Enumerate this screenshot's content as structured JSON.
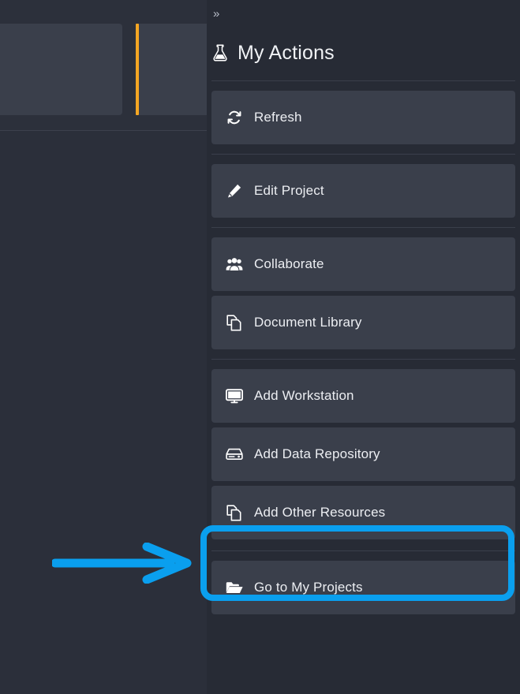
{
  "window": {
    "background_color": "#272b35",
    "panel_background_color": "#272b35",
    "card_color": "#3a3f4b"
  },
  "left_pane": {
    "accent_bar_color": "#f5a623",
    "card_color": "#3a3f4b",
    "background_color": "#2c303b"
  },
  "panel": {
    "collapse_chevron": "»",
    "title": "My Actions",
    "title_icon": "flask-icon",
    "groups": [
      {
        "group_name": "refresh-group",
        "items": [
          {
            "label": "Refresh",
            "icon": "refresh-icon",
            "tight": false
          }
        ]
      },
      {
        "group_name": "edit-group",
        "items": [
          {
            "label": "Edit Project",
            "icon": "pencil-icon",
            "tight": false
          }
        ]
      },
      {
        "group_name": "collaborate-group",
        "items": [
          {
            "label": "Collaborate",
            "icon": "users-icon",
            "tight": false
          },
          {
            "label": "Document Library",
            "icon": "copy-files-icon",
            "tight": true
          }
        ]
      },
      {
        "group_name": "add-resources-group",
        "items": [
          {
            "label": "Add Workstation",
            "icon": "desktop-monitor-icon",
            "tight": false
          },
          {
            "label": "Add Data Repository",
            "icon": "hard-drive-icon",
            "tight": true
          },
          {
            "label": "Add Other Resources",
            "icon": "copy-files-icon",
            "tight": true,
            "highlighted": true
          }
        ]
      },
      {
        "group_name": "projects-group",
        "items": [
          {
            "label": "Go to My Projects",
            "icon": "open-folder-icon",
            "tight": false
          }
        ]
      }
    ]
  },
  "annotation": {
    "highlight_color": "#0a9fee",
    "highlight_target": "Add Other Resources",
    "arrow_direction": "right",
    "arrow_color": "#0a9fee"
  }
}
